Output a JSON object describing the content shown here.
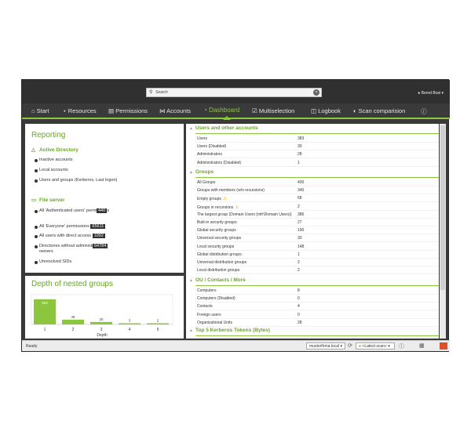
{
  "search": {
    "placeholder": "Search"
  },
  "user": {
    "name": "Bernd Bosi"
  },
  "nav": {
    "tabs": [
      {
        "label": "Start"
      },
      {
        "label": "Resources"
      },
      {
        "label": "Permissions"
      },
      {
        "label": "Accounts"
      },
      {
        "label": "Dashboard"
      },
      {
        "label": "Multiselection"
      },
      {
        "label": "Logbook"
      },
      {
        "label": "Scan comparision"
      }
    ],
    "active": "Dashboard"
  },
  "reporting": {
    "title": "Reporting",
    "ad_title": "Active Directory",
    "ad_items": [
      "Inactive accounts",
      "Local accounts",
      "Users and groups (Kerberos, Last logon)"
    ],
    "fs_title": "File server",
    "fs_items": [
      {
        "label": "All 'Authenticated users' permissions",
        "badge": "440"
      },
      {
        "label": "All 'Everyone' permissions",
        "badge": "65611"
      },
      {
        "label": "All users with direct access",
        "badge": "1092"
      },
      {
        "label": "Directories without administrative owners",
        "badge": "64784"
      },
      {
        "label": "Unresolved SIDs",
        "badge": ""
      }
    ]
  },
  "depth": {
    "title": "Depth of nested groups",
    "xlabel": "Depth"
  },
  "chart_data": {
    "type": "bar",
    "title": "Depth of nested groups",
    "xlabel": "Depth",
    "categories": [
      "1",
      "2",
      "3",
      "4",
      "5"
    ],
    "values": [
      253,
      48,
      25,
      3,
      2
    ],
    "color": "#8cc63f"
  },
  "users_section": {
    "title": "Users and other accounts",
    "rows": [
      {
        "label": "Users",
        "value": "383"
      },
      {
        "label": "Users (Disabled)",
        "value": "30"
      },
      {
        "label": "Administrators",
        "value": "28"
      },
      {
        "label": "Administrators (Disabled)",
        "value": "1"
      }
    ]
  },
  "groups_section": {
    "title": "Groups",
    "rows": [
      {
        "label": "All Groups",
        "value": "400"
      },
      {
        "label": "Groups with members (w/o recursions)",
        "value": "340"
      },
      {
        "label": "Empty groups",
        "value": "58",
        "warn": true
      },
      {
        "label": "Groups in recursions",
        "value": "2",
        "warn": true
      },
      {
        "label": "The largest group (Domain Users (mfr\\Domain Users))",
        "value": "386"
      },
      {
        "label": "Built-in security groups",
        "value": "27"
      },
      {
        "label": "Global security groups",
        "value": "190"
      },
      {
        "label": "Universal security groups",
        "value": "30"
      },
      {
        "label": "Local security groups",
        "value": "148"
      },
      {
        "label": "Global distribution groups",
        "value": "1"
      },
      {
        "label": "Universal distribution groups",
        "value": "2"
      },
      {
        "label": "Local distribution groups",
        "value": "2"
      }
    ]
  },
  "ou_section": {
    "title": "OU / Contacts / More",
    "rows": [
      {
        "label": "Computers",
        "value": "8"
      },
      {
        "label": "Computers (Disabled)",
        "value": "0"
      },
      {
        "label": "Contacts",
        "value": "4"
      },
      {
        "label": "Foreign users",
        "value": "0"
      },
      {
        "label": "Organizational Units",
        "value": "28"
      }
    ]
  },
  "kerberos_section": {
    "title": "Top 5 Kerberos Tokens (Bytes)"
  },
  "status": {
    "text": "Ready",
    "domain": "musterfirma.local",
    "scan": "<Latest scan>"
  }
}
